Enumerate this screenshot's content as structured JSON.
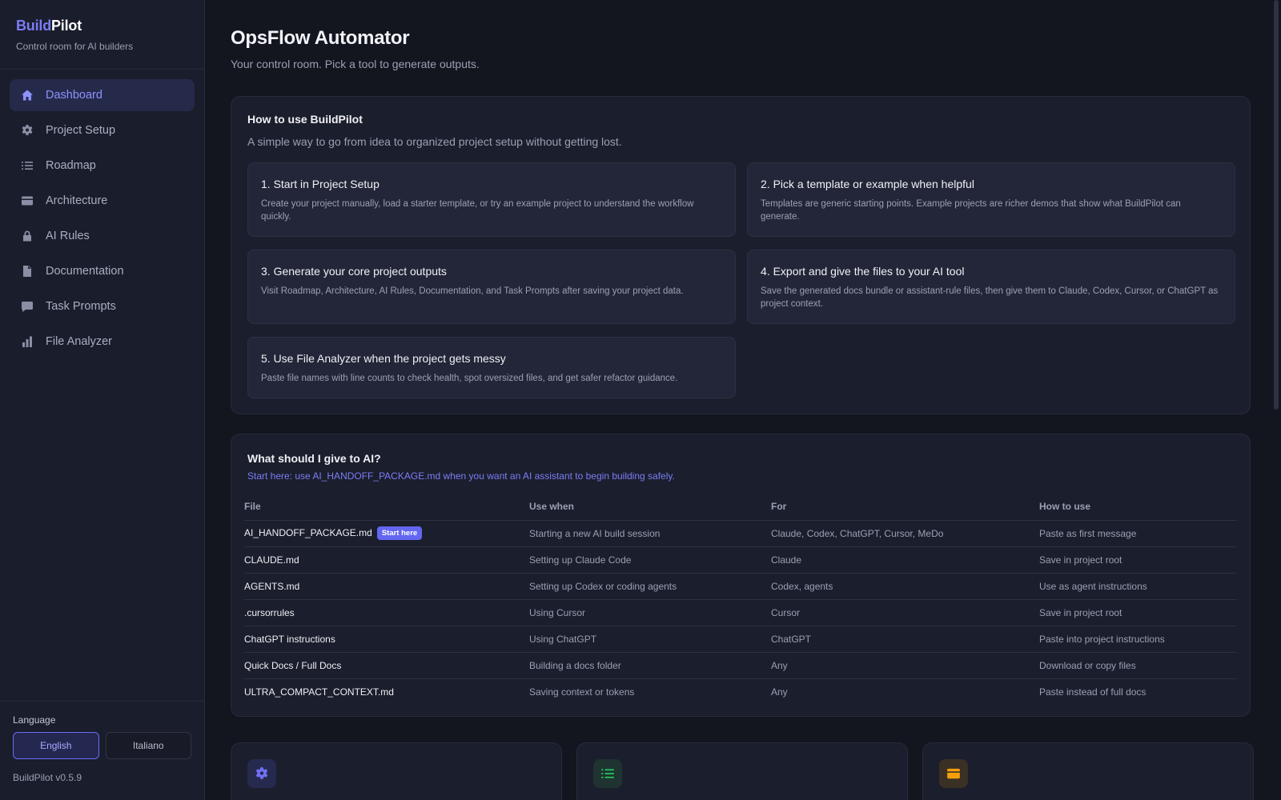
{
  "brand": {
    "accent": "Build",
    "rest": "Pilot",
    "subtitle": "Control room for AI builders"
  },
  "nav": [
    {
      "label": "Dashboard",
      "icon": "home-icon",
      "active": true
    },
    {
      "label": "Project Setup",
      "icon": "gear-icon"
    },
    {
      "label": "Roadmap",
      "icon": "list-icon"
    },
    {
      "label": "Architecture",
      "icon": "card-icon"
    },
    {
      "label": "AI Rules",
      "icon": "lock-icon"
    },
    {
      "label": "Documentation",
      "icon": "document-icon"
    },
    {
      "label": "Task Prompts",
      "icon": "chat-icon"
    },
    {
      "label": "File Analyzer",
      "icon": "bar-chart-icon"
    }
  ],
  "language": {
    "label": "Language",
    "english": "English",
    "italian": "Italiano",
    "selected": "English"
  },
  "version": "BuildPilot v0.5.9",
  "page": {
    "title": "OpsFlow Automator",
    "subtitle": "Your control room. Pick a tool to generate outputs."
  },
  "howto": {
    "title": "How to use BuildPilot",
    "desc": "A simple way to go from idea to organized project setup without getting lost.",
    "steps": [
      {
        "title": "1. Start in Project Setup",
        "desc": "Create your project manually, load a starter template, or try an example project to understand the workflow quickly."
      },
      {
        "title": "2. Pick a template or example when helpful",
        "desc": "Templates are generic starting points. Example projects are richer demos that show what BuildPilot can generate."
      },
      {
        "title": "3. Generate your core project outputs",
        "desc": "Visit Roadmap, Architecture, AI Rules, Documentation, and Task Prompts after saving your project data."
      },
      {
        "title": "4. Export and give the files to your AI tool",
        "desc": "Save the generated docs bundle or assistant-rule files, then give them to Claude, Codex, Cursor, or ChatGPT as project context."
      },
      {
        "title": "5. Use File Analyzer when the project gets messy",
        "desc": "Paste file names with line counts to check health, spot oversized files, and get safer refactor guidance."
      }
    ]
  },
  "give": {
    "title": "What should I give to AI?",
    "note": "Start here: use AI_HANDOFF_PACKAGE.md when you want an AI assistant to begin building safely.",
    "columns": [
      "File",
      "Use when",
      "For",
      "How to use"
    ],
    "badge": "Start here",
    "rows": [
      [
        "AI_HANDOFF_PACKAGE.md",
        "Starting a new AI build session",
        "Claude, Codex, ChatGPT, Cursor, MeDo",
        "Paste as first message"
      ],
      [
        "CLAUDE.md",
        "Setting up Claude Code",
        "Claude",
        "Save in project root"
      ],
      [
        "AGENTS.md",
        "Setting up Codex or coding agents",
        "Codex, agents",
        "Use as agent instructions"
      ],
      [
        ".cursorrules",
        "Using Cursor",
        "Cursor",
        "Save in project root"
      ],
      [
        "ChatGPT instructions",
        "Using ChatGPT",
        "ChatGPT",
        "Paste into project instructions"
      ],
      [
        "Quick Docs / Full Docs",
        "Building a docs folder",
        "Any",
        "Download or copy files"
      ],
      [
        "ULTRA_COMPACT_CONTEXT.md",
        "Saving context or tokens",
        "Any",
        "Paste instead of full docs"
      ]
    ]
  },
  "cards": [
    {
      "icon": "gear-icon",
      "color": "#6366f1",
      "bg": "#272a4f"
    },
    {
      "icon": "list-icon",
      "color": "#22c55e",
      "bg": "#1f3330"
    },
    {
      "icon": "card-icon",
      "color": "#f59e0b",
      "bg": "#3a3024"
    }
  ],
  "colors": {
    "accent": "#6366f1",
    "background": "#13151f",
    "sidebar": "#1a1d2b"
  }
}
